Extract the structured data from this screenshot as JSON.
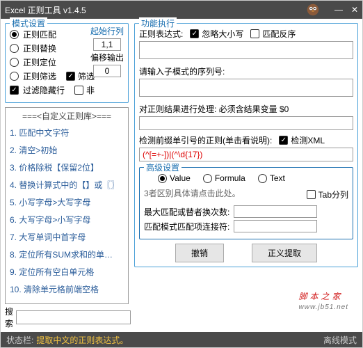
{
  "window": {
    "title": "Excel 正则工具 v1.4.5"
  },
  "mode": {
    "legend": "模式设置",
    "startcol_label": "起始行列",
    "startcol_value": "1,1",
    "offset_label": "偏移输出",
    "offset_value": "0",
    "items": [
      "正则匹配",
      "正则替换",
      "正则定位",
      "正则筛选",
      "过滤隐藏行"
    ],
    "filter_label": "筛选",
    "fei_label": "非"
  },
  "lib": {
    "header": "===<自定义正则库>===",
    "items": [
      "1. 匹配中文字符",
      "2. 清空>初始",
      "3. 价格除税【保留2位】",
      "4. 替换计算式中的【】或〖〗",
      "5. 小写字母>大写字母",
      "6. 大写字母>小写字母",
      "7. 大写单词中首字母",
      "8. 定位所有SUM求和的单…",
      "9. 定位所有空白单元格",
      "10. 清除单元格前端空格"
    ]
  },
  "search": {
    "label": "搜索"
  },
  "exec": {
    "legend": "功能执行",
    "expr_label": "正则表达式:",
    "ignorecase": "忽略大小写",
    "reverse": "匹配反序",
    "sub_label": "请输入子模式的序列号:",
    "post_label": "对正则结果进行处理: 必须含结果变量 $0",
    "prefix_label": "检测前缀单引号的正则(单击看说明):",
    "xml_label": "检测XML",
    "prefix_value": "(^[=+-])|(^\\d{17})"
  },
  "adv": {
    "legend": "高级设置",
    "value": "Value",
    "formula": "Formula",
    "text": "Text",
    "hint": "3者区别具体请点击此处。",
    "tab_label": "Tab分列",
    "max_label": "最大匹配或替者换次数:",
    "join_label": "匹配模式匹配项连接符:"
  },
  "buttons": {
    "undo": "撤销",
    "run": "正义提取"
  },
  "status": {
    "label": "状态栏:",
    "value": "提取中文的正则表达式。",
    "right": "离线模式"
  },
  "watermark": {
    "main": "脚本之家",
    "sub": "www.jb51.net"
  }
}
